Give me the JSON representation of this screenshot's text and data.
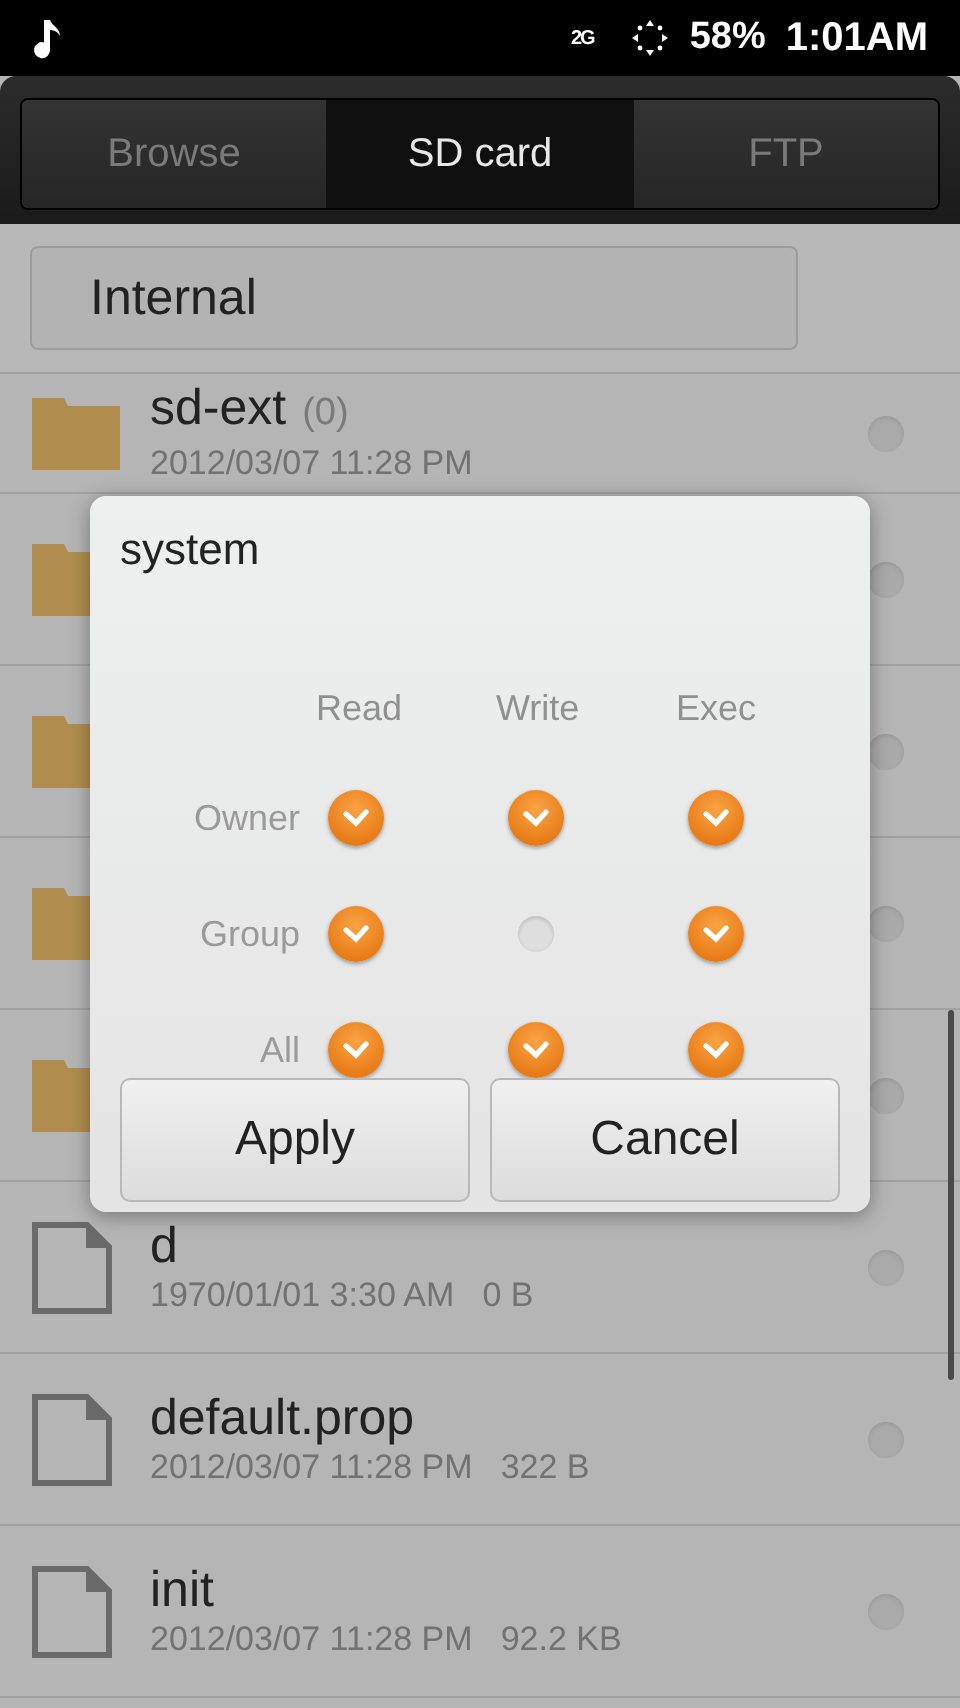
{
  "status_bar": {
    "network": "2G",
    "battery": "58%",
    "time": "1:01AM"
  },
  "tabs": [
    {
      "label": "Browse",
      "selected": false
    },
    {
      "label": "SD card",
      "selected": true
    },
    {
      "label": "FTP",
      "selected": false
    }
  ],
  "path": {
    "value": "Internal"
  },
  "files": [
    {
      "kind": "folder",
      "name": "sd-ext",
      "count": "(0)",
      "date": "2012/03/07 11:28 PM",
      "selected": false
    },
    {
      "kind": "folder",
      "selected": false
    },
    {
      "kind": "folder",
      "selected": false
    },
    {
      "kind": "folder",
      "selected": false
    },
    {
      "kind": "folder",
      "selected": false
    },
    {
      "kind": "file",
      "name": "d",
      "date": "1970/01/01 3:30 AM",
      "size": "0 B",
      "selected": false
    },
    {
      "kind": "file",
      "name": "default.prop",
      "date": "2012/03/07 11:28 PM",
      "size": "322 B",
      "selected": false
    },
    {
      "kind": "file",
      "name": "init",
      "date": "2012/03/07 11:28 PM",
      "size": "92.2 KB",
      "selected": false
    }
  ],
  "dialog": {
    "title": "system",
    "columns": [
      "Read",
      "Write",
      "Exec"
    ],
    "rows": [
      {
        "label": "Owner",
        "cells": [
          {
            "checked": true
          },
          {
            "checked": true
          },
          {
            "checked": true
          }
        ]
      },
      {
        "label": "Group",
        "cells": [
          {
            "checked": true
          },
          {
            "checked": false
          },
          {
            "checked": true
          }
        ]
      },
      {
        "label": "All",
        "cells": [
          {
            "checked": true
          },
          {
            "checked": true
          },
          {
            "checked": true
          }
        ]
      }
    ],
    "buttons": [
      "Apply",
      "Cancel"
    ]
  }
}
